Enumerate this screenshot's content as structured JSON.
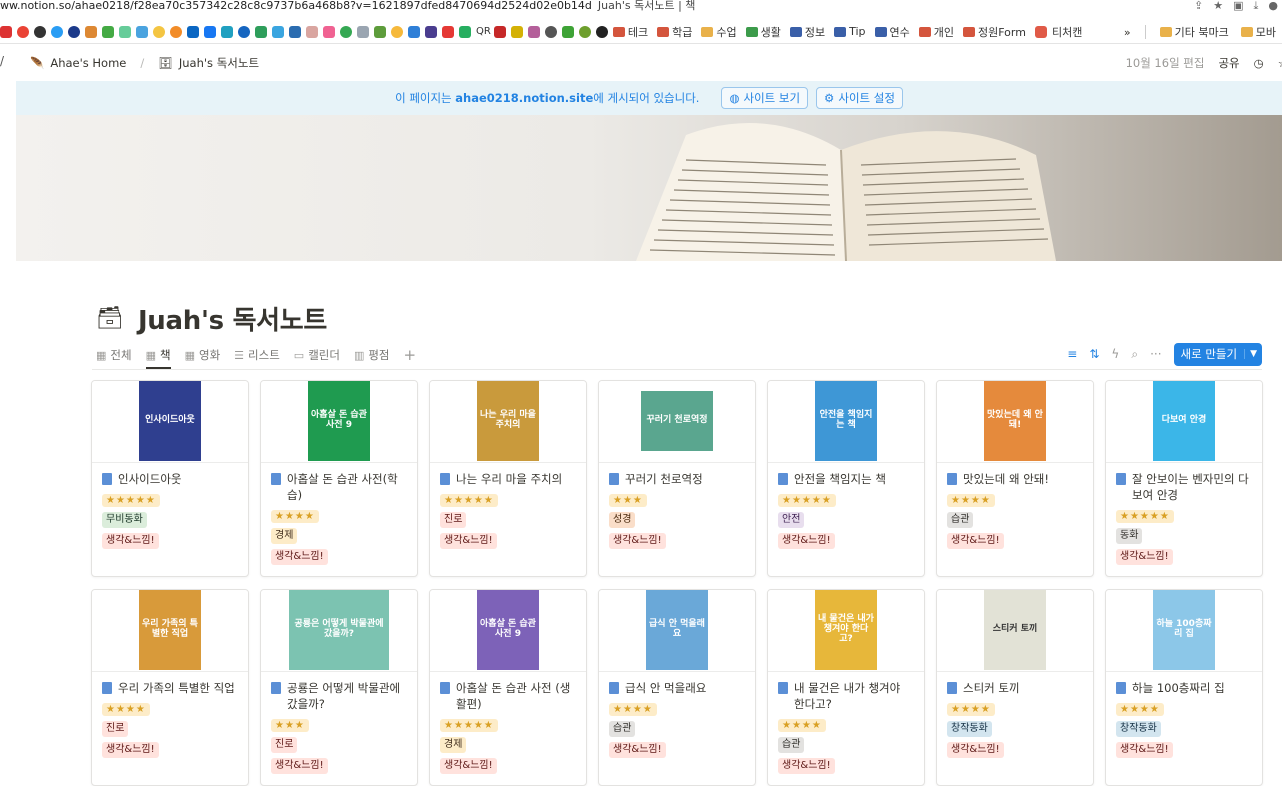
{
  "browser": {
    "url": "ww.notion.so/ahae0218/f28ea70c357342c28c8c9737b6a468b8?v=1621897dfed8470694d2524d02e0b14d",
    "tab_title": "Juah's 독서노트 | 책"
  },
  "bookmarks": {
    "folders": [
      {
        "label": "테크",
        "color": "red"
      },
      {
        "label": "학급",
        "color": "red"
      },
      {
        "label": "수업",
        "color": "yellow"
      },
      {
        "label": "생활",
        "color": "green"
      },
      {
        "label": "정보",
        "color": "blue"
      },
      {
        "label": "Tip",
        "color": "blue"
      },
      {
        "label": "연수",
        "color": "blue"
      },
      {
        "label": "개인",
        "color": "red"
      },
      {
        "label": "정원Form",
        "color": "red"
      },
      {
        "label": "티처캔",
        "color": "red"
      }
    ],
    "overflow": "»",
    "other_folder": "기타 북마크",
    "mobile_folder": "모바"
  },
  "topbar": {
    "home_crumb": "Ahae's Home",
    "page_crumb": "Juah's 독서노트",
    "edited": "10월 16일 편집",
    "share": "공유"
  },
  "banner": {
    "prefix": "이 페이지는",
    "site": "ahae0218.notion.site",
    "suffix": "에 게시되어 있습니다.",
    "view_site": "사이트 보기",
    "site_settings": "사이트 설정"
  },
  "page": {
    "title": "Juah's 독서노트"
  },
  "tabs": [
    {
      "label": "전체",
      "glyph": "▦"
    },
    {
      "label": "책",
      "glyph": "▦▦"
    },
    {
      "label": "영화",
      "glyph": "▦▦"
    },
    {
      "label": "리스트",
      "glyph": "☰"
    },
    {
      "label": "캘린더",
      "glyph": "▭"
    },
    {
      "label": "평점",
      "glyph": "▥"
    }
  ],
  "new_button": "새로 만들기",
  "books": [
    {
      "title": "인사이드아웃",
      "stars": "★★★★★",
      "tags": [
        {
          "label": "무비동화",
          "color": "green"
        },
        {
          "label": "생각&느낌!",
          "color": "red"
        }
      ],
      "cover_text": "인사이드아웃",
      "cover_color": "#2f3f8f"
    },
    {
      "title": "아홉살 돈 습관 사전(학습)",
      "stars": "★★★★",
      "tags": [
        {
          "label": "경제",
          "color": "yellow"
        },
        {
          "label": "생각&느낌!",
          "color": "red"
        }
      ],
      "cover_text": "아홉살 돈 습관 사전 9",
      "cover_color": "#1f9b50"
    },
    {
      "title": "나는 우리 마을 주치의",
      "stars": "★★★★★",
      "tags": [
        {
          "label": "진로",
          "color": "red"
        },
        {
          "label": "생각&느낌!",
          "color": "red"
        }
      ],
      "cover_text": "나는 우리 마을 주치의",
      "cover_color": "#c99a3c"
    },
    {
      "title": "꾸러기 천로역정",
      "stars": "★★★",
      "tags": [
        {
          "label": "성경",
          "color": "orange"
        },
        {
          "label": "생각&느낌!",
          "color": "red"
        }
      ],
      "cover_text": "꾸러기 천로역정",
      "cover_color": "#5aa68f"
    },
    {
      "title": "안전을 책임지는 책",
      "stars": "★★★★★",
      "tags": [
        {
          "label": "안전",
          "color": "purple"
        },
        {
          "label": "생각&느낌!",
          "color": "red"
        }
      ],
      "cover_text": "안전을 책임지는 책",
      "cover_color": "#3e97d6"
    },
    {
      "title": "맛있는데 왜 안돼!",
      "stars": "★★★★",
      "tags": [
        {
          "label": "습관",
          "color": "gray"
        },
        {
          "label": "생각&느낌!",
          "color": "red"
        }
      ],
      "cover_text": "맛있는데 왜 안돼!",
      "cover_color": "#e58a3c"
    },
    {
      "title": "잘 안보이는 벤자민의 다보여 안경",
      "stars": "★★★★★",
      "tags": [
        {
          "label": "동화",
          "color": "gray"
        },
        {
          "label": "생각&느낌!",
          "color": "red"
        }
      ],
      "cover_text": "다보여 안경",
      "cover_color": "#3bb6e8"
    },
    {
      "title": "우리 가족의 특별한 직업",
      "stars": "★★★★",
      "tags": [
        {
          "label": "진로",
          "color": "red"
        },
        {
          "label": "생각&느낌!",
          "color": "red"
        }
      ],
      "cover_text": "우리 가족의 특별한 직업",
      "cover_color": "#d89a3a"
    },
    {
      "title": "공룡은 어떻게 박물관에 갔을까?",
      "stars": "★★★",
      "tags": [
        {
          "label": "진로",
          "color": "red"
        },
        {
          "label": "생각&느낌!",
          "color": "red"
        }
      ],
      "cover_text": "공룡은 어떻게 박물관에 갔을까?",
      "cover_color": "#7cc3b1"
    },
    {
      "title": "아홉살 돈 습관 사전 (생활편)",
      "stars": "★★★★★",
      "tags": [
        {
          "label": "경제",
          "color": "yellow"
        },
        {
          "label": "생각&느낌!",
          "color": "red"
        }
      ],
      "cover_text": "아홉살 돈 습관 사전 9",
      "cover_color": "#7d62b8"
    },
    {
      "title": "급식 안 먹을래요",
      "stars": "★★★★",
      "tags": [
        {
          "label": "습관",
          "color": "gray"
        },
        {
          "label": "생각&느낌!",
          "color": "red"
        }
      ],
      "cover_text": "급식 안 먹을래요",
      "cover_color": "#6aa8d8"
    },
    {
      "title": "내 물건은 내가 챙겨야 한다고?",
      "stars": "★★★★",
      "tags": [
        {
          "label": "습관",
          "color": "gray"
        },
        {
          "label": "생각&느낌!",
          "color": "red"
        }
      ],
      "cover_text": "내 물건은 내가 챙겨야 한다고?",
      "cover_color": "#e7b73a"
    },
    {
      "title": "스티커 토끼",
      "stars": "★★★★",
      "tags": [
        {
          "label": "창작동화",
          "color": "blue"
        },
        {
          "label": "생각&느낌!",
          "color": "red"
        }
      ],
      "cover_text": "스티커 토끼",
      "cover_color": "#e2e2d6"
    },
    {
      "title": "하늘 100층짜리 집",
      "stars": "★★★★",
      "tags": [
        {
          "label": "창작동화",
          "color": "blue"
        },
        {
          "label": "생각&느낌!",
          "color": "red"
        }
      ],
      "cover_text": "하늘 100층짜리 집",
      "cover_color": "#8cc7e8"
    }
  ]
}
